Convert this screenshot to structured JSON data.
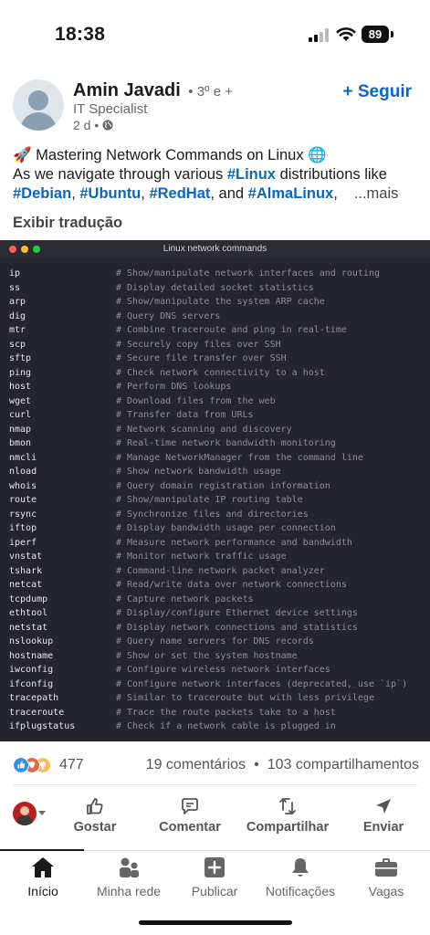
{
  "status_bar": {
    "time": "18:38",
    "battery": "89"
  },
  "post": {
    "author": {
      "name": "Amin Javadi",
      "degree": "• 3º e +",
      "title": "IT Specialist",
      "age": "2 d •"
    },
    "follow_label": "+ Seguir",
    "text": {
      "line1": "🚀 Mastering Network Commands on Linux 🌐",
      "line2_prefix": "As we navigate through various ",
      "line2_tag": "#Linux",
      "line2_suffix": " distributions like",
      "tag_debian": "#Debian",
      "sep1": ", ",
      "tag_ubuntu": "#Ubuntu",
      "sep2": ", ",
      "tag_redhat": "#RedHat",
      "sep3": ", and ",
      "tag_almalinux": "#AlmaLinux",
      "sep4": ",",
      "more": "...mais"
    },
    "translate_label": "Exibir tradução"
  },
  "terminal": {
    "title": "Linux network commands",
    "lines": [
      {
        "cmd": "ip",
        "comment": "# Show/manipulate network interfaces and routing"
      },
      {
        "cmd": "ss",
        "comment": "# Display detailed socket statistics"
      },
      {
        "cmd": "arp",
        "comment": "# Show/manipulate the system ARP cache"
      },
      {
        "cmd": "dig",
        "comment": "# Query DNS servers"
      },
      {
        "cmd": "mtr",
        "comment": "# Combine traceroute and ping in real-time"
      },
      {
        "cmd": "scp",
        "comment": "# Securely copy files over SSH"
      },
      {
        "cmd": "sftp",
        "comment": "# Secure file transfer over SSH"
      },
      {
        "cmd": "ping",
        "comment": "# Check network connectivity to a host"
      },
      {
        "cmd": "host",
        "comment": "# Perform DNS lookups"
      },
      {
        "cmd": "wget",
        "comment": "# Download files from the web"
      },
      {
        "cmd": "curl",
        "comment": "# Transfer data from URLs"
      },
      {
        "cmd": "nmap",
        "comment": "# Network scanning and discovery"
      },
      {
        "cmd": "bmon",
        "comment": "# Real-time network bandwidth monitoring"
      },
      {
        "cmd": "nmcli",
        "comment": "# Manage NetworkManager from the command line"
      },
      {
        "cmd": "nload",
        "comment": "# Show network bandwidth usage"
      },
      {
        "cmd": "whois",
        "comment": "# Query domain registration information"
      },
      {
        "cmd": "route",
        "comment": "# Show/manipulate IP routing table"
      },
      {
        "cmd": "rsync",
        "comment": "# Synchronize files and directories"
      },
      {
        "cmd": "iftop",
        "comment": "# Display bandwidth usage per connection"
      },
      {
        "cmd": "iperf",
        "comment": "# Measure network performance and bandwidth"
      },
      {
        "cmd": "vnstat",
        "comment": "# Monitor network traffic usage"
      },
      {
        "cmd": "tshark",
        "comment": "# Command-line network packet analyzer"
      },
      {
        "cmd": "netcat",
        "comment": "# Read/write data over network connections"
      },
      {
        "cmd": "tcpdump",
        "comment": "# Capture network packets"
      },
      {
        "cmd": "ethtool",
        "comment": "# Display/configure Ethernet device settings"
      },
      {
        "cmd": "netstat",
        "comment": "# Display network connections and statistics"
      },
      {
        "cmd": "nslookup",
        "comment": "# Query name servers for DNS records"
      },
      {
        "cmd": "hostname",
        "comment": "# Show or set the system hostname"
      },
      {
        "cmd": "iwconfig",
        "comment": "# Configure wireless network interfaces"
      },
      {
        "cmd": "ifconfig",
        "comment": "# Configure network interfaces (deprecated, use `ip`)"
      },
      {
        "cmd": "tracepath",
        "comment": "# Similar to traceroute but with less privilege"
      },
      {
        "cmd": "traceroute",
        "comment": "# Trace the route packets take to a host"
      },
      {
        "cmd": "ifplugstatus",
        "comment": "# Check if a network cable is plugged in"
      }
    ]
  },
  "social": {
    "reaction_count": "477",
    "comments": "19 comentários",
    "separator": "•",
    "shares": "103 compartilhamentos",
    "reaction_icons": [
      "like-icon",
      "celebrate-icon",
      "insightful-icon"
    ]
  },
  "actions": {
    "like": "Gostar",
    "comment": "Comentar",
    "share": "Compartilhar",
    "send": "Enviar"
  },
  "nav": {
    "home": "Início",
    "network": "Minha rede",
    "post": "Publicar",
    "notifications": "Notificações",
    "jobs": "Vagas"
  },
  "colors": {
    "accent": "#0a66c2",
    "terminal_bg": "#24252d"
  }
}
